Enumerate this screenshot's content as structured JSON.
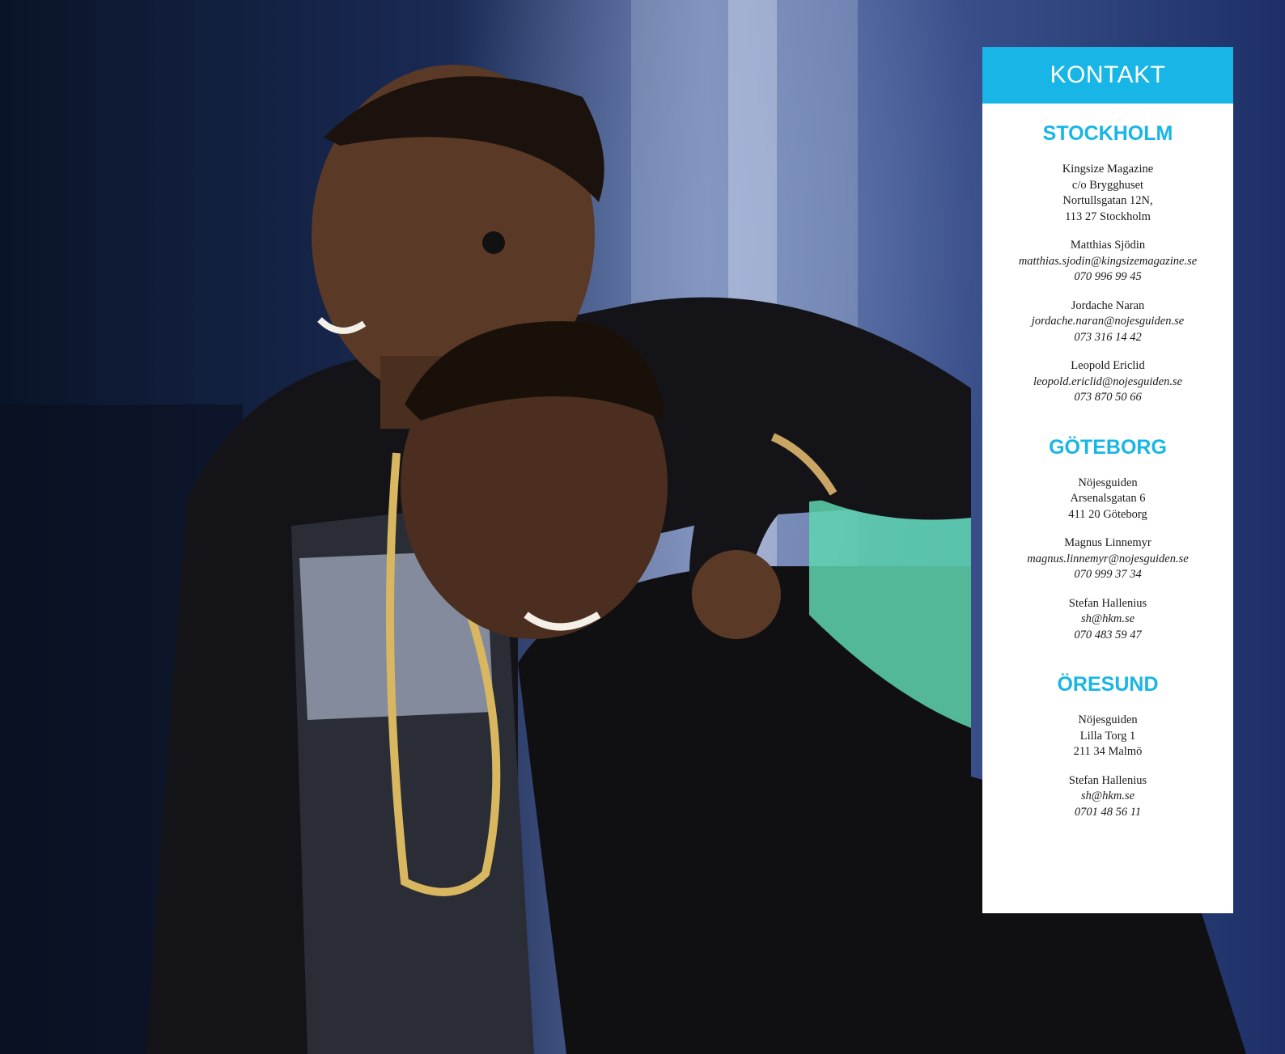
{
  "photo": {
    "alt_icon": "concert-photo"
  },
  "kontakt": {
    "title": "KONTAKT",
    "accent_color": "#17b6e6",
    "sections": [
      {
        "title": "STOCKHOLM",
        "address": [
          "Kingsize Magazine",
          "c/o Brygghuset",
          "Nortullsgatan 12N,",
          "113 27 Stockholm"
        ],
        "contacts": [
          {
            "name": "Matthias Sjödin",
            "email": "matthias.sjodin@kingsizemagazine.se",
            "phone": "070 996 99 45"
          },
          {
            "name": "Jordache Naran",
            "email": "jordache.naran@nojesguiden.se",
            "phone": "073 316 14 42"
          },
          {
            "name": "Leopold Ericlid",
            "email": "leopold.ericlid@nojesguiden.se",
            "phone": "073 870 50 66"
          }
        ]
      },
      {
        "title": "GÖTEBORG",
        "address": [
          "Nöjesguiden",
          "Arsenalsgatan 6",
          "411 20 Göteborg"
        ],
        "contacts": [
          {
            "name": "Magnus Linnemyr",
            "email": "magnus.linnemyr@nojesguiden.se",
            "phone": "070 999 37 34"
          },
          {
            "name": "Stefan Hallenius",
            "email": "sh@hkm.se",
            "phone": "070 483 59 47"
          }
        ]
      },
      {
        "title": "ÖRESUND",
        "address": [
          "Nöjesguiden",
          "Lilla Torg 1",
          "211 34 Malmö"
        ],
        "contacts": [
          {
            "name": "Stefan Hallenius",
            "email": "sh@hkm.se",
            "phone": "0701 48 56 11"
          }
        ]
      }
    ]
  }
}
